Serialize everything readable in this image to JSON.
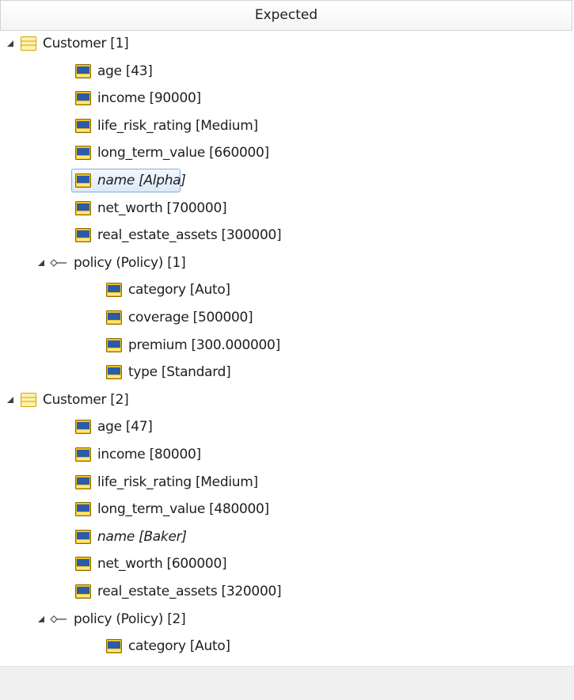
{
  "header": {
    "title": "Expected"
  },
  "tree": [
    {
      "kind": "entity",
      "level": 0,
      "expanded": true,
      "label": "Customer [1]",
      "italic": false,
      "selected": false
    },
    {
      "kind": "attr",
      "level": 1,
      "label": "age [43]",
      "italic": false,
      "selected": false
    },
    {
      "kind": "attr",
      "level": 1,
      "label": "income [90000]",
      "italic": false,
      "selected": false
    },
    {
      "kind": "attr",
      "level": 1,
      "label": "life_risk_rating [Medium]",
      "italic": false,
      "selected": false
    },
    {
      "kind": "attr",
      "level": 1,
      "label": "long_term_value [660000]",
      "italic": false,
      "selected": false
    },
    {
      "kind": "attr",
      "level": 1,
      "label": "name [Alpha]",
      "italic": true,
      "selected": true
    },
    {
      "kind": "attr",
      "level": 1,
      "label": "net_worth [700000]",
      "italic": false,
      "selected": false
    },
    {
      "kind": "attr",
      "level": 1,
      "label": "real_estate_assets [300000]",
      "italic": false,
      "selected": false
    },
    {
      "kind": "relation",
      "level": 1,
      "expanded": true,
      "label": "policy (Policy) [1]",
      "italic": false,
      "selected": false
    },
    {
      "kind": "attr",
      "level": 2,
      "label": "category [Auto]",
      "italic": false,
      "selected": false
    },
    {
      "kind": "attr",
      "level": 2,
      "label": "coverage [500000]",
      "italic": false,
      "selected": false
    },
    {
      "kind": "attr",
      "level": 2,
      "label": "premium [300.000000]",
      "italic": false,
      "selected": false
    },
    {
      "kind": "attr",
      "level": 2,
      "label": "type [Standard]",
      "italic": false,
      "selected": false
    },
    {
      "kind": "entity",
      "level": 0,
      "expanded": true,
      "label": "Customer [2]",
      "italic": false,
      "selected": false
    },
    {
      "kind": "attr",
      "level": 1,
      "label": "age [47]",
      "italic": false,
      "selected": false
    },
    {
      "kind": "attr",
      "level": 1,
      "label": "income [80000]",
      "italic": false,
      "selected": false
    },
    {
      "kind": "attr",
      "level": 1,
      "label": "life_risk_rating [Medium]",
      "italic": false,
      "selected": false
    },
    {
      "kind": "attr",
      "level": 1,
      "label": "long_term_value [480000]",
      "italic": false,
      "selected": false
    },
    {
      "kind": "attr",
      "level": 1,
      "label": "name [Baker]",
      "italic": true,
      "selected": false
    },
    {
      "kind": "attr",
      "level": 1,
      "label": "net_worth [600000]",
      "italic": false,
      "selected": false
    },
    {
      "kind": "attr",
      "level": 1,
      "label": "real_estate_assets [320000]",
      "italic": false,
      "selected": false
    },
    {
      "kind": "relation",
      "level": 1,
      "expanded": true,
      "label": "policy (Policy) [2]",
      "italic": false,
      "selected": false
    },
    {
      "kind": "attr",
      "level": 2,
      "label": "category [Auto]",
      "italic": false,
      "selected": false
    }
  ],
  "colors": {
    "selection_border": "#84acdd",
    "attr_icon_fill": "#2a5caa",
    "attr_icon_frame": "#f0c020",
    "entity_icon_fill": "#fff2b0",
    "entity_icon_frame": "#d4a400"
  }
}
